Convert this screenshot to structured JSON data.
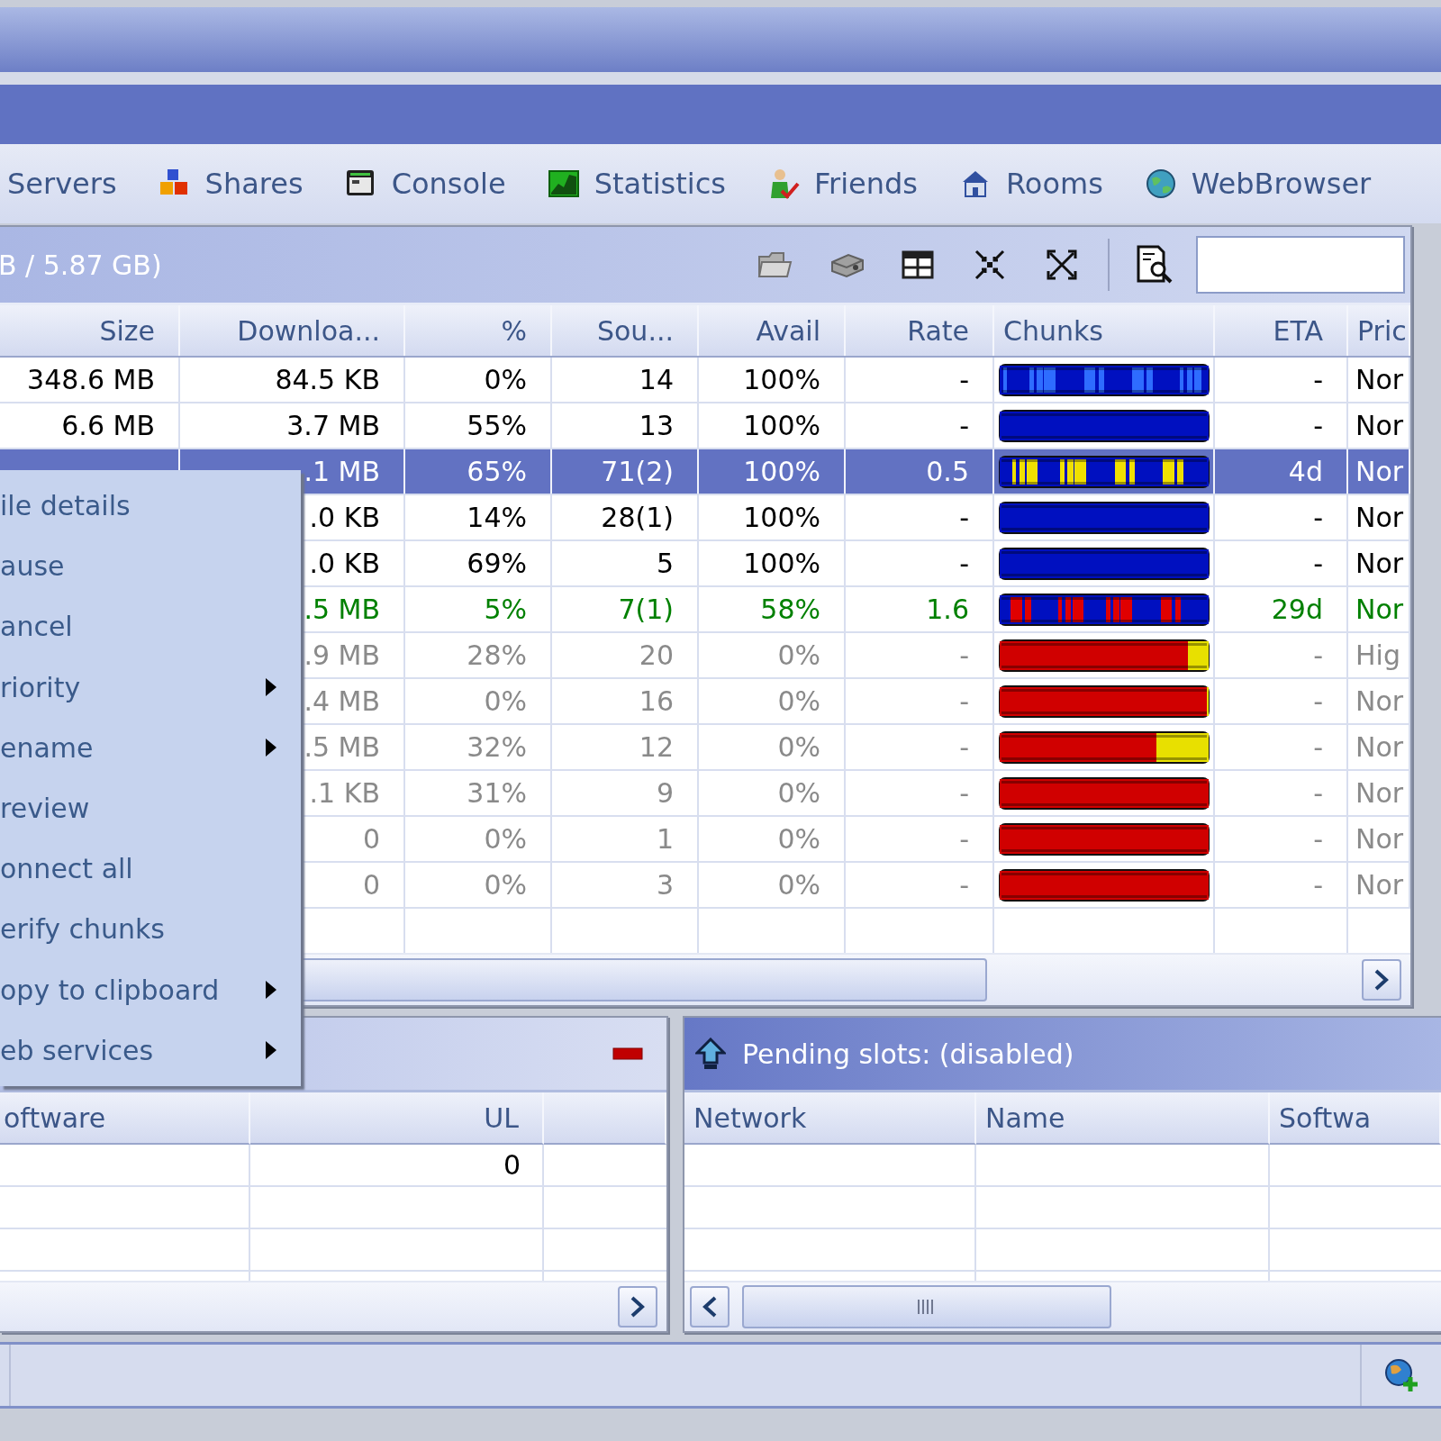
{
  "tabs": [
    {
      "label": "Servers",
      "selected": false
    },
    {
      "label": "Shares",
      "selected": false
    },
    {
      "label": "Console",
      "selected": false
    },
    {
      "label": "Statistics",
      "selected": false
    },
    {
      "label": "Friends",
      "selected": false
    },
    {
      "label": "Rooms",
      "selected": false
    },
    {
      "label": "WebBrowser",
      "selected": false
    }
  ],
  "downloads": {
    "title": "B / 5.87 GB)",
    "columns": [
      "Size",
      "Downloa...",
      "%",
      "Sou...",
      "Avail",
      "Rate",
      "Chunks",
      "ETA",
      "Pric"
    ],
    "rows": [
      {
        "size": "348.6 MB",
        "downloaded": "84.5 KB",
        "percent": "0%",
        "sources": "14",
        "avail": "100%",
        "rate": "-",
        "chunks": [
          {
            "kind": "base",
            "color": "#0010c0"
          },
          {
            "kind": "stripes",
            "color": "#2e6cff"
          }
        ],
        "eta": "-",
        "priority": "Nor",
        "kind": "normal",
        "selected": false
      },
      {
        "size": "6.6 MB",
        "downloaded": "3.7 MB",
        "percent": "55%",
        "sources": "13",
        "avail": "100%",
        "rate": "-",
        "chunks": [
          {
            "kind": "base",
            "color": "#0010c0"
          }
        ],
        "eta": "-",
        "priority": "Nor",
        "kind": "normal",
        "selected": false
      },
      {
        "downloaded": ".1 MB",
        "percent": "65%",
        "sources": "71(2)",
        "avail": "100%",
        "rate": "0.5",
        "chunks": [
          {
            "kind": "base",
            "color": "#0010c0"
          },
          {
            "kind": "stripes",
            "color": "#f0e000"
          }
        ],
        "eta": "4d",
        "priority": "Nor",
        "kind": "normal",
        "selected": true
      },
      {
        "downloaded": ".0 KB",
        "percent": "14%",
        "sources": "28(1)",
        "avail": "100%",
        "rate": "-",
        "chunks": [
          {
            "kind": "base",
            "color": "#0010c0"
          }
        ],
        "eta": "-",
        "priority": "Nor",
        "kind": "normal",
        "selected": false
      },
      {
        "downloaded": ".0 KB",
        "percent": "69%",
        "sources": "5",
        "avail": "100%",
        "rate": "-",
        "chunks": [
          {
            "kind": "base",
            "color": "#0010c0"
          }
        ],
        "eta": "-",
        "priority": "Nor",
        "kind": "normal",
        "selected": false
      },
      {
        "downloaded": ".5 MB",
        "percent": "5%",
        "sources": "7(1)",
        "avail": "58%",
        "rate": "1.6",
        "chunks": [
          {
            "kind": "base",
            "color": "#0010c0"
          },
          {
            "kind": "stripes",
            "color": "#e00000"
          }
        ],
        "eta": "29d",
        "priority": "Nor",
        "kind": "active",
        "selected": false
      },
      {
        "downloaded": ".9 MB",
        "percent": "28%",
        "sources": "20",
        "avail": "0%",
        "rate": "-",
        "chunks": [
          {
            "kind": "base",
            "color": "#d00000",
            "level": 0.9
          },
          {
            "kind": "rest",
            "color": "#e8e000"
          }
        ],
        "eta": "-",
        "priority": "Hig",
        "kind": "queued",
        "selected": false
      },
      {
        "downloaded": ".4 MB",
        "percent": "0%",
        "sources": "16",
        "avail": "0%",
        "rate": "-",
        "chunks": [
          {
            "kind": "base",
            "color": "#d00000",
            "level": 0.99
          },
          {
            "kind": "rest",
            "color": "#e8e000"
          }
        ],
        "eta": "-",
        "priority": "Nor",
        "kind": "queued",
        "selected": false
      },
      {
        "downloaded": ".5 MB",
        "percent": "32%",
        "sources": "12",
        "avail": "0%",
        "rate": "-",
        "chunks": [
          {
            "kind": "base",
            "color": "#d00000",
            "level": 0.75
          },
          {
            "kind": "rest",
            "color": "#e8e000"
          }
        ],
        "eta": "-",
        "priority": "Nor",
        "kind": "queued",
        "selected": false
      },
      {
        "downloaded": ".1 KB",
        "percent": "31%",
        "sources": "9",
        "avail": "0%",
        "rate": "-",
        "chunks": [
          {
            "kind": "base",
            "color": "#d00000"
          }
        ],
        "eta": "-",
        "priority": "Nor",
        "kind": "queued",
        "selected": false
      },
      {
        "downloaded": "0",
        "percent": "0%",
        "sources": "1",
        "avail": "0%",
        "rate": "-",
        "chunks": [
          {
            "kind": "base",
            "color": "#d00000"
          }
        ],
        "eta": "-",
        "priority": "Nor",
        "kind": "queued",
        "selected": false
      },
      {
        "downloaded": "0",
        "percent": "0%",
        "sources": "3",
        "avail": "0%",
        "rate": "-",
        "chunks": [
          {
            "kind": "base",
            "color": "#d00000"
          }
        ],
        "eta": "-",
        "priority": "Nor",
        "kind": "queued",
        "selected": false
      }
    ]
  },
  "context_menu": [
    {
      "label": "ile details",
      "submenu": false
    },
    {
      "label": "ause",
      "submenu": false
    },
    {
      "label": "ancel",
      "submenu": false
    },
    {
      "label": "riority",
      "submenu": true
    },
    {
      "label": "ename",
      "submenu": true
    },
    {
      "label": "review",
      "submenu": false
    },
    {
      "label": "onnect all",
      "submenu": false
    },
    {
      "label": "erify chunks",
      "submenu": false
    },
    {
      "label": "opy to clipboard",
      "submenu": true
    },
    {
      "label": "eb services",
      "submenu": true
    }
  ],
  "uploaders": {
    "columns": [
      "oftware",
      "UL"
    ],
    "rows": [
      {
        "ul": "0"
      }
    ]
  },
  "pending": {
    "title": "Pending slots: (disabled)",
    "columns": [
      "Network",
      "Name",
      "Softwa"
    ]
  }
}
